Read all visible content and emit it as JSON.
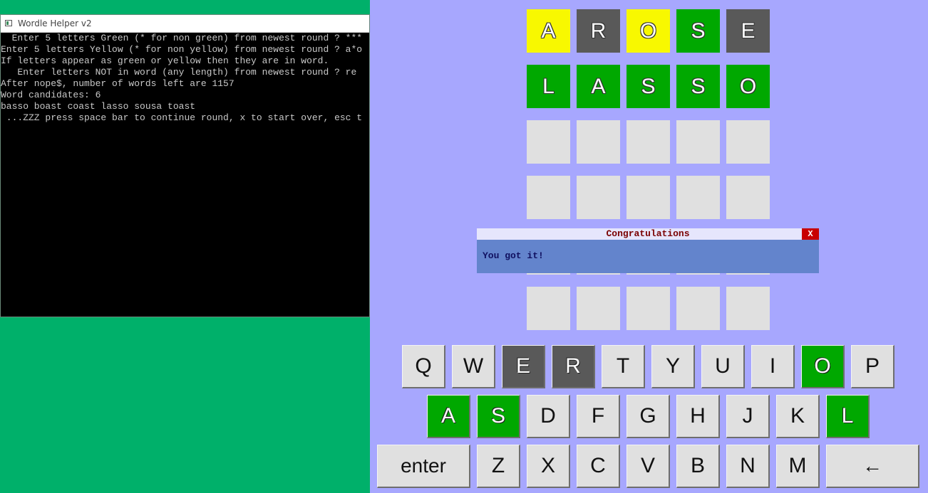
{
  "console": {
    "title": "Wordle Helper v2",
    "lines": [
      "  Enter 5 letters Green (* for non green) from newest round ? ***",
      "Enter 5 letters Yellow (* for non yellow) from newest round ? a*o",
      "If letters appear as green or yellow then they are in word.",
      "   Enter letters NOT in word (any length) from newest round ? re",
      "After nope$, number of words left are 1157",
      "Word candidates: 6",
      "basso boast coast lasso sousa toast",
      " ...ZZZ press space bar to continue round, x to start over, esc t"
    ]
  },
  "board": {
    "rows": [
      [
        {
          "letter": "A",
          "state": "yellow"
        },
        {
          "letter": "R",
          "state": "gray"
        },
        {
          "letter": "O",
          "state": "yellow"
        },
        {
          "letter": "S",
          "state": "green"
        },
        {
          "letter": "E",
          "state": "gray"
        }
      ],
      [
        {
          "letter": "L",
          "state": "green"
        },
        {
          "letter": "A",
          "state": "green"
        },
        {
          "letter": "S",
          "state": "green"
        },
        {
          "letter": "S",
          "state": "green"
        },
        {
          "letter": "O",
          "state": "green"
        }
      ],
      [
        {
          "letter": "",
          "state": "empty"
        },
        {
          "letter": "",
          "state": "empty"
        },
        {
          "letter": "",
          "state": "empty"
        },
        {
          "letter": "",
          "state": "empty"
        },
        {
          "letter": "",
          "state": "empty"
        }
      ],
      [
        {
          "letter": "",
          "state": "empty"
        },
        {
          "letter": "",
          "state": "empty"
        },
        {
          "letter": "",
          "state": "empty"
        },
        {
          "letter": "",
          "state": "empty"
        },
        {
          "letter": "",
          "state": "empty"
        }
      ],
      [
        {
          "letter": "",
          "state": "empty"
        },
        {
          "letter": "",
          "state": "empty"
        },
        {
          "letter": "",
          "state": "empty"
        },
        {
          "letter": "",
          "state": "empty"
        },
        {
          "letter": "",
          "state": "empty"
        }
      ],
      [
        {
          "letter": "",
          "state": "empty"
        },
        {
          "letter": "",
          "state": "empty"
        },
        {
          "letter": "",
          "state": "empty"
        },
        {
          "letter": "",
          "state": "empty"
        },
        {
          "letter": "",
          "state": "empty"
        }
      ]
    ]
  },
  "keyboard": {
    "rows": [
      [
        {
          "label": "Q",
          "state": "default"
        },
        {
          "label": "W",
          "state": "default"
        },
        {
          "label": "E",
          "state": "gray"
        },
        {
          "label": "R",
          "state": "gray"
        },
        {
          "label": "T",
          "state": "default"
        },
        {
          "label": "Y",
          "state": "default"
        },
        {
          "label": "U",
          "state": "default"
        },
        {
          "label": "I",
          "state": "default"
        },
        {
          "label": "O",
          "state": "green"
        },
        {
          "label": "P",
          "state": "default"
        }
      ],
      [
        {
          "label": "A",
          "state": "green"
        },
        {
          "label": "S",
          "state": "green"
        },
        {
          "label": "D",
          "state": "default"
        },
        {
          "label": "F",
          "state": "default"
        },
        {
          "label": "G",
          "state": "default"
        },
        {
          "label": "H",
          "state": "default"
        },
        {
          "label": "J",
          "state": "default"
        },
        {
          "label": "K",
          "state": "default"
        },
        {
          "label": "L",
          "state": "green"
        }
      ],
      [
        {
          "label": "enter",
          "state": "default"
        },
        {
          "label": "Z",
          "state": "default"
        },
        {
          "label": "X",
          "state": "default"
        },
        {
          "label": "C",
          "state": "default"
        },
        {
          "label": "V",
          "state": "default"
        },
        {
          "label": "B",
          "state": "default"
        },
        {
          "label": "N",
          "state": "default"
        },
        {
          "label": "M",
          "state": "default"
        },
        {
          "label": "←",
          "state": "default"
        }
      ]
    ]
  },
  "dialog": {
    "title": "Congratulations",
    "close_label": "X",
    "message": "You got it!"
  },
  "colors": {
    "green_tile": "#00a800",
    "yellow_tile": "#f8f800",
    "gray_tile": "#595959",
    "empty_tile": "#e0e0e0",
    "game_background": "#a7a7fe",
    "desktop_background": "#00b06a"
  }
}
